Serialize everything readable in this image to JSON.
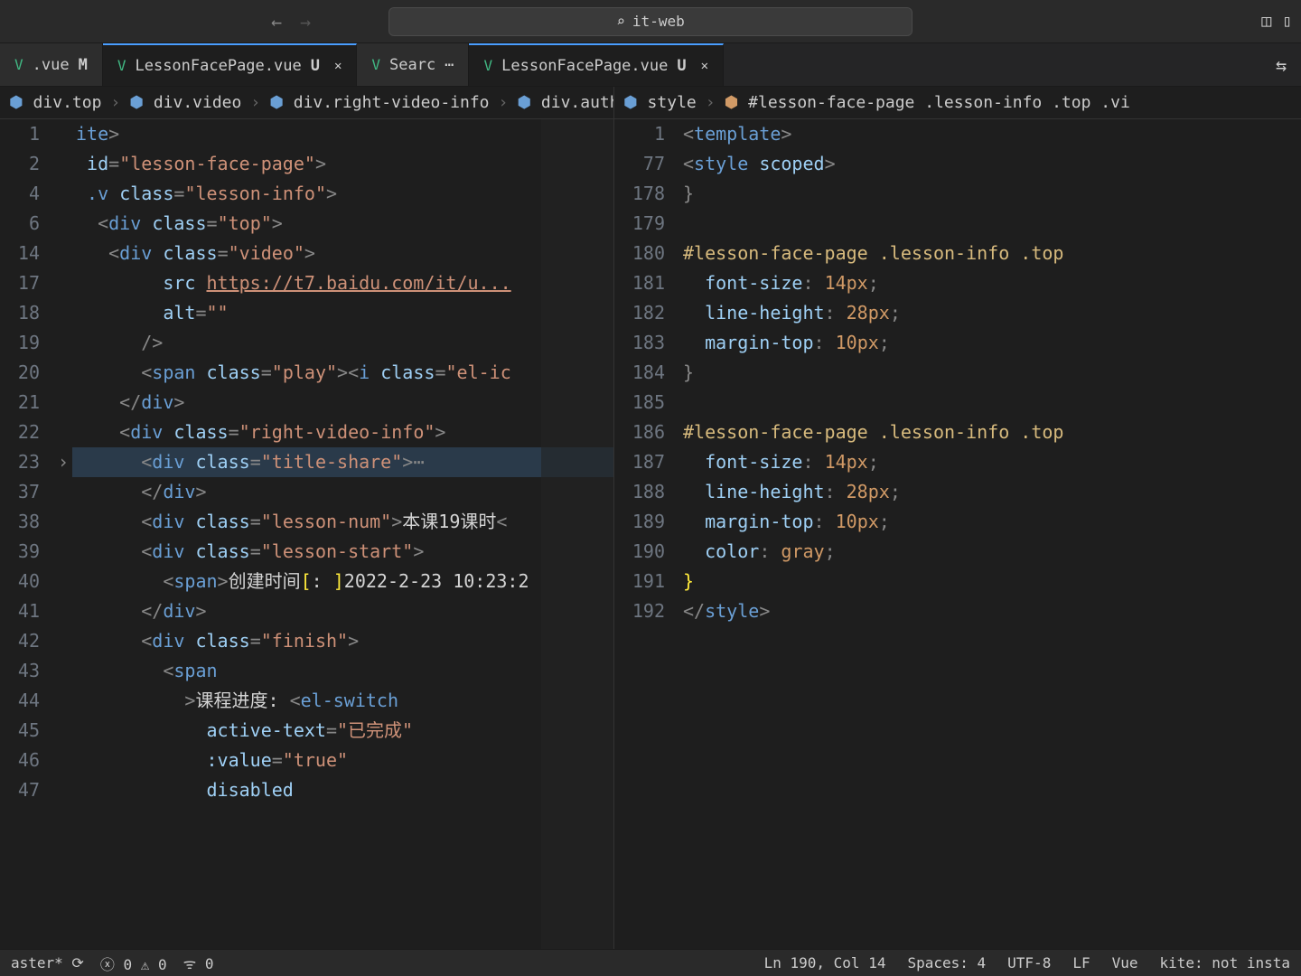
{
  "titlebar": {
    "search_text": "it-web"
  },
  "tabs": {
    "left": [
      {
        "name": ".vue",
        "status": "M",
        "close": false
      },
      {
        "name": "LessonFacePage.vue",
        "status": "U",
        "close": true,
        "active": true
      },
      {
        "name": "Searc",
        "status": "",
        "ellipsis": "⋯"
      }
    ],
    "right": [
      {
        "name": "LessonFacePage.vue",
        "status": "U",
        "close": true,
        "active": true
      }
    ]
  },
  "breadcrumbs": {
    "left": [
      "div.top",
      "div.video",
      "div.right-video-info",
      "div.auth"
    ],
    "right": [
      "style",
      "#lesson-face-page .lesson-info .top .vi"
    ]
  },
  "leftEditor": {
    "lines": [
      {
        "n": 1,
        "html": "<span class='tok-tag'>ite</span><span class='tok-punct'>&gt;</span>"
      },
      {
        "n": 2,
        "html": " <span class='tok-attr'>id</span><span class='tok-punct'>=</span><span class='tok-str'>\"lesson-face-page\"</span><span class='tok-punct'>&gt;</span>"
      },
      {
        "n": 4,
        "html": " <span class='tok-tag'>.v</span> <span class='tok-attr'>class</span><span class='tok-punct'>=</span><span class='tok-str'>\"lesson-info\"</span><span class='tok-punct'>&gt;</span>"
      },
      {
        "n": 6,
        "html": "  <span class='tok-punct'>&lt;</span><span class='tok-tag'>div</span> <span class='tok-attr'>class</span><span class='tok-punct'>=</span><span class='tok-str'>\"top\"</span><span class='tok-punct'>&gt;</span>"
      },
      {
        "n": 14,
        "html": "   <span class='tok-punct'>&lt;</span><span class='tok-tag'>div</span> <span class='tok-attr'>class</span><span class='tok-punct'>=</span><span class='tok-str'>\"video\"</span><span class='tok-punct'>&gt;</span>"
      },
      {
        "n": 17,
        "html": "        <span class='tok-attr'>src</span> <span class='tok-str' style='text-decoration:underline'>https://t7.baidu.com/it/u...</span>"
      },
      {
        "n": 18,
        "html": "        <span class='tok-attr'>alt</span><span class='tok-punct'>=</span><span class='tok-str'>\"\"</span>"
      },
      {
        "n": 19,
        "html": "      <span class='tok-punct'>/&gt;</span>"
      },
      {
        "n": 20,
        "html": "      <span class='tok-punct'>&lt;</span><span class='tok-tag'>span</span> <span class='tok-attr'>class</span><span class='tok-punct'>=</span><span class='tok-str'>\"play\"</span><span class='tok-punct'>&gt;&lt;</span><span class='tok-tag'>i</span> <span class='tok-attr'>class</span><span class='tok-punct'>=</span><span class='tok-str'>\"el-ic</span>"
      },
      {
        "n": 21,
        "html": "    <span class='tok-punct'>&lt;/</span><span class='tok-tag'>div</span><span class='tok-punct'>&gt;</span>"
      },
      {
        "n": 22,
        "html": "    <span class='tok-punct'>&lt;</span><span class='tok-tag'>div</span> <span class='tok-attr'>class</span><span class='tok-punct'>=</span><span class='tok-str'>\"right-video-info\"</span><span class='tok-punct'>&gt;</span>"
      },
      {
        "n": 23,
        "html": "      <span class='tok-punct'>&lt;</span><span class='tok-tag'>div</span> <span class='tok-attr'>class</span><span class='tok-punct'>=</span><span class='tok-str'>\"title-share\"</span><span class='tok-punct'>&gt;</span><span class='tok-punct'>⋯</span>",
        "fold": true,
        "hl": true
      },
      {
        "n": 37,
        "html": "      <span class='tok-punct'>&lt;/</span><span class='tok-tag'>div</span><span class='tok-punct'>&gt;</span>"
      },
      {
        "n": 38,
        "html": "      <span class='tok-punct'>&lt;</span><span class='tok-tag'>div</span> <span class='tok-attr'>class</span><span class='tok-punct'>=</span><span class='tok-str'>\"lesson-num\"</span><span class='tok-punct'>&gt;</span><span class='tok-text'>本课19课时</span><span class='tok-punct'>&lt;</span>"
      },
      {
        "n": 39,
        "html": "      <span class='tok-punct'>&lt;</span><span class='tok-tag'>div</span> <span class='tok-attr'>class</span><span class='tok-punct'>=</span><span class='tok-str'>\"lesson-start\"</span><span class='tok-punct'>&gt;</span>"
      },
      {
        "n": 40,
        "html": "        <span class='tok-punct'>&lt;</span><span class='tok-tag'>span</span><span class='tok-punct'>&gt;</span><span class='tok-text'>创建时间</span><span class='tok-bracket'>[</span><span class='tok-text'>: </span><span class='tok-bracket'>]</span><span class='tok-text'>2022-2-23 10:23:2</span>"
      },
      {
        "n": 41,
        "html": "      <span class='tok-punct'>&lt;/</span><span class='tok-tag'>div</span><span class='tok-punct'>&gt;</span>"
      },
      {
        "n": 42,
        "html": "      <span class='tok-punct'>&lt;</span><span class='tok-tag'>div</span> <span class='tok-attr'>class</span><span class='tok-punct'>=</span><span class='tok-str'>\"finish\"</span><span class='tok-punct'>&gt;</span>"
      },
      {
        "n": 43,
        "html": "        <span class='tok-punct'>&lt;</span><span class='tok-tag'>span</span>"
      },
      {
        "n": 44,
        "html": "          <span class='tok-punct'>&gt;</span><span class='tok-text'>课程进度: </span><span class='tok-punct'>&lt;</span><span class='tok-tag'>el-switch</span>"
      },
      {
        "n": 45,
        "html": "            <span class='tok-attr'>active-text</span><span class='tok-punct'>=</span><span class='tok-str'>\"已完成\"</span>"
      },
      {
        "n": 46,
        "html": "            <span class='tok-attr'>:value</span><span class='tok-punct'>=</span><span class='tok-str'>\"true\"</span>"
      },
      {
        "n": 47,
        "html": "            <span class='tok-attr'>disabled</span>"
      }
    ]
  },
  "rightEditor": {
    "lines": [
      {
        "n": 1,
        "html": "<span class='tok-punct'>&lt;</span><span class='tok-tag'>template</span><span class='tok-punct'>&gt;</span>"
      },
      {
        "n": 77,
        "html": "<span class='tok-punct'>&lt;</span><span class='tok-tag'>style</span> <span class='tok-attr'>scoped</span><span class='tok-punct'>&gt;</span>"
      },
      {
        "n": 178,
        "html": "<span class='tok-punct'>}</span>"
      },
      {
        "n": 179,
        "html": ""
      },
      {
        "n": 180,
        "html": "<span class='tok-sel'>#lesson-face-page .lesson-info .top</span>"
      },
      {
        "n": 181,
        "html": "  <span class='tok-prop'>font-size</span><span class='tok-punct'>:</span> <span class='tok-val'>14px</span><span class='tok-punct'>;</span>"
      },
      {
        "n": 182,
        "html": "  <span class='tok-prop'>line-height</span><span class='tok-punct'>:</span> <span class='tok-val'>28px</span><span class='tok-punct'>;</span>"
      },
      {
        "n": 183,
        "html": "  <span class='tok-prop'>margin-top</span><span class='tok-punct'>:</span> <span class='tok-val'>10px</span><span class='tok-punct'>;</span>"
      },
      {
        "n": 184,
        "html": "<span class='tok-punct'>}</span>"
      },
      {
        "n": 185,
        "html": ""
      },
      {
        "n": 186,
        "html": "<span class='tok-sel'>#lesson-face-page .lesson-info .top</span>"
      },
      {
        "n": 187,
        "html": "  <span class='tok-prop'>font-size</span><span class='tok-punct'>:</span> <span class='tok-val'>14px</span><span class='tok-punct'>;</span>"
      },
      {
        "n": 188,
        "html": "  <span class='tok-prop'>line-height</span><span class='tok-punct'>:</span> <span class='tok-val'>28px</span><span class='tok-punct'>;</span>"
      },
      {
        "n": 189,
        "html": "  <span class='tok-prop'>margin-top</span><span class='tok-punct'>:</span> <span class='tok-val'>10px</span><span class='tok-punct'>;</span>"
      },
      {
        "n": 190,
        "html": "  <span class='tok-prop'>color</span><span class='tok-punct'>:</span> <span class='tok-val'>gray</span><span class='tok-punct'>;</span>",
        "cursor": true
      },
      {
        "n": 191,
        "html": "<span class='tok-bracket'>}</span>"
      },
      {
        "n": 192,
        "html": "<span class='tok-punct'>&lt;/</span><span class='tok-tag'>style</span><span class='tok-punct'>&gt;</span>"
      }
    ]
  },
  "statusbar": {
    "branch": "aster*",
    "errors": "0",
    "warnings": "0",
    "radio": "0",
    "cursor": "Ln 190, Col 14",
    "spaces": "Spaces: 4",
    "encoding": "UTF-8",
    "eol": "LF",
    "lang": "Vue",
    "kite": "kite: not insta"
  }
}
